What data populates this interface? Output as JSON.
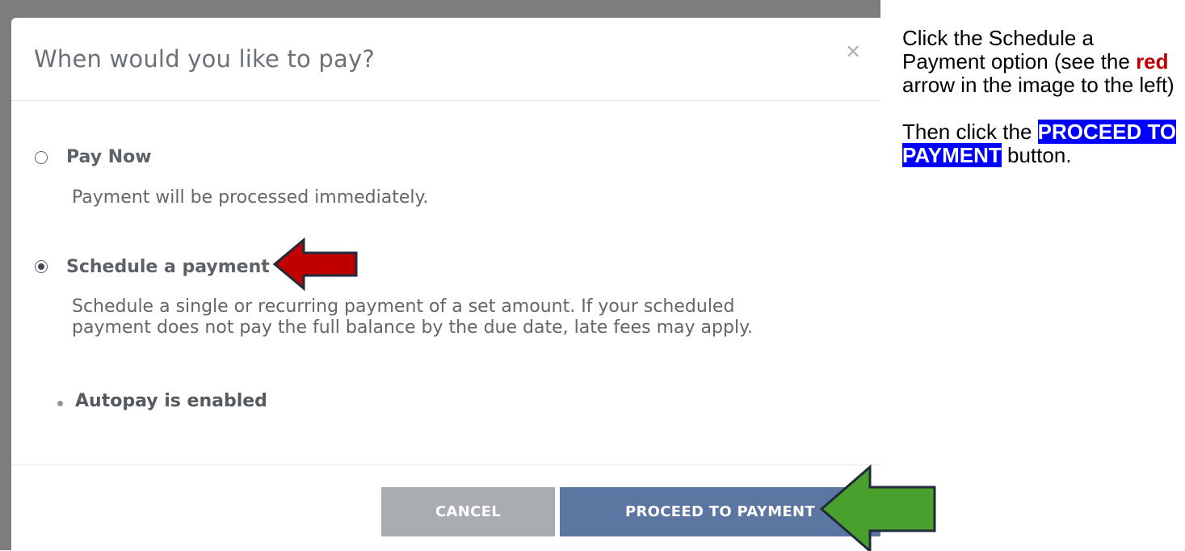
{
  "modal": {
    "title": "When would you like to pay?",
    "close_glyph": "×",
    "options": [
      {
        "label": "Pay Now",
        "description": "Payment will be processed immediately.",
        "selected": false
      },
      {
        "label": "Schedule a payment",
        "description_line1": "Schedule a single or recurring payment of a set amount. If your scheduled",
        "description_line2": "payment does not pay the full balance by the due date, late fees may apply.",
        "selected": true
      }
    ],
    "bullet": "Autopay is enabled",
    "cancel_label": "CANCEL",
    "proceed_label": "PROCEED TO PAYMENT"
  },
  "instructions": {
    "p1_before": "Click the Schedule a Payment option (see the ",
    "p1_red": "red",
    "p1_after": " arrow in the image to the left)",
    "p2_before": "Then click the ",
    "p2_highlight": "PROCEED TO PAYMENT",
    "p2_after": " button."
  },
  "annotations": {
    "red_arrow": {
      "color": "#c00000",
      "points_to": "Schedule a payment"
    },
    "green_arrow": {
      "color": "#4aa02c",
      "points_to": "PROCEED TO PAYMENT"
    }
  },
  "colors": {
    "proceed_button": "#5c76a2",
    "cancel_button": "#a9adb2",
    "highlight": "#0000ff"
  }
}
